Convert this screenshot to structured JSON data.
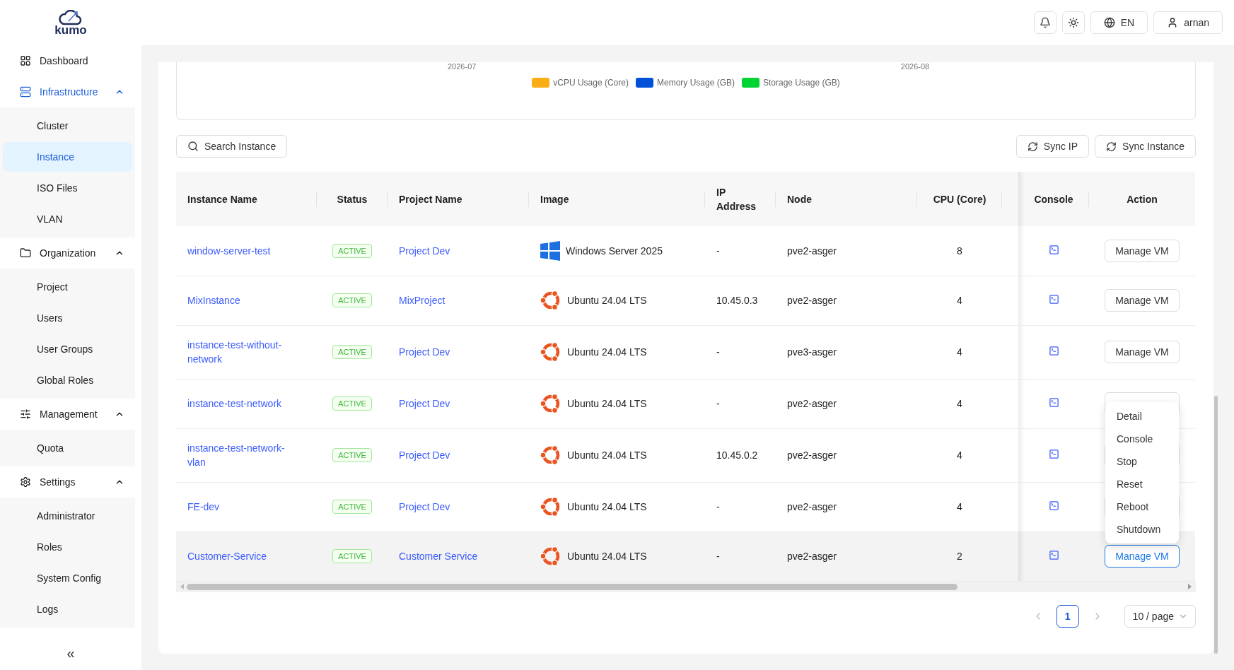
{
  "logo": {
    "text": "kumo"
  },
  "sidebar": {
    "items": [
      {
        "label": "Dashboard",
        "selected": false
      },
      {
        "label": "Infrastructure",
        "selected": true,
        "expanded": true,
        "children": [
          {
            "label": "Cluster",
            "selected": false
          },
          {
            "label": "Instance",
            "selected": true
          },
          {
            "label": "ISO Files",
            "selected": false
          },
          {
            "label": "VLAN",
            "selected": false
          }
        ]
      },
      {
        "label": "Organization",
        "selected": false,
        "expanded": true,
        "children": [
          {
            "label": "Project",
            "selected": false
          },
          {
            "label": "Users",
            "selected": false
          },
          {
            "label": "User Groups",
            "selected": false
          },
          {
            "label": "Global Roles",
            "selected": false
          }
        ]
      },
      {
        "label": "Management",
        "selected": false,
        "expanded": true,
        "children": [
          {
            "label": "Quota",
            "selected": false
          }
        ]
      },
      {
        "label": "Settings",
        "selected": false,
        "expanded": true,
        "children": [
          {
            "label": "Administrator",
            "selected": false
          },
          {
            "label": "Roles",
            "selected": false
          },
          {
            "label": "System Config",
            "selected": false
          },
          {
            "label": "Logs",
            "selected": false
          }
        ]
      }
    ],
    "collapse": "«"
  },
  "header": {
    "language": "EN",
    "user": "arnan"
  },
  "chart": {
    "xticks": [
      "2026-07",
      "2026-08"
    ],
    "legend": [
      {
        "label": "vCPU Usage (Core)",
        "color": "#faad14"
      },
      {
        "label": "Memory Usage (GB)",
        "color": "#0050d8"
      },
      {
        "label": "Storage Usage (GB)",
        "color": "#00d334"
      }
    ]
  },
  "toolbar": {
    "search": "Search Instance",
    "buttons": [
      "Sync IP",
      "Sync Instance"
    ]
  },
  "table": {
    "columns": [
      "Instance Name",
      "Status",
      "Project Name",
      "Image",
      "IP Address",
      "Node",
      "CPU (Core)",
      "Console",
      "Action"
    ],
    "rows": [
      {
        "name": "window-server-test",
        "status": "ACTIVE",
        "project": "Project Dev",
        "kind": "windows",
        "image": "Windows Server 2025",
        "ip": "-",
        "node": "pve2-asger",
        "cpu": "8",
        "action": "Manage VM",
        "active": false,
        "highlighted": false
      },
      {
        "name": "MixInstance",
        "status": "ACTIVE",
        "project": "MixProject",
        "kind": "ubuntu",
        "image": "Ubuntu 24.04 LTS",
        "ip": "10.45.0.3",
        "node": "pve2-asger",
        "cpu": "4",
        "action": "Manage VM",
        "active": false,
        "highlighted": false
      },
      {
        "name": "instance-test-without-network",
        "status": "ACTIVE",
        "project": "Project Dev",
        "kind": "ubuntu",
        "image": "Ubuntu 24.04 LTS",
        "ip": "-",
        "node": "pve3-asger",
        "cpu": "4",
        "action": "Manage VM",
        "active": false,
        "highlighted": false
      },
      {
        "name": "instance-test-network",
        "status": "ACTIVE",
        "project": "Project Dev",
        "kind": "ubuntu",
        "image": "Ubuntu 24.04 LTS",
        "ip": "-",
        "node": "pve2-asger",
        "cpu": "4",
        "active": false,
        "highlighted": false
      },
      {
        "name": "instance-test-network-vlan",
        "status": "ACTIVE",
        "project": "Project Dev",
        "kind": "ubuntu",
        "image": "Ubuntu 24.04 LTS",
        "ip": "10.45.0.2",
        "node": "pve2-asger",
        "cpu": "4",
        "active": false,
        "highlighted": false
      },
      {
        "name": "FE-dev",
        "status": "ACTIVE",
        "project": "Project Dev",
        "kind": "ubuntu",
        "image": "Ubuntu 24.04 LTS",
        "ip": "-",
        "node": "pve2-asger",
        "cpu": "4",
        "active": false,
        "highlighted": false
      },
      {
        "name": "Customer-Service",
        "status": "ACTIVE",
        "project": "Customer Service",
        "kind": "ubuntu",
        "image": "Ubuntu 24.04 LTS",
        "ip": "-",
        "node": "pve2-asger",
        "cpu": "2",
        "action": "Manage VM",
        "active": true,
        "highlighted": true
      }
    ]
  },
  "menu": {
    "items": [
      "Detail",
      "Console",
      "Stop",
      "Reset",
      "Reboot",
      "Shutdown"
    ]
  },
  "pagination": {
    "pages": [
      {
        "label": "1",
        "selected": true
      }
    ],
    "page_size": "10 / page"
  }
}
